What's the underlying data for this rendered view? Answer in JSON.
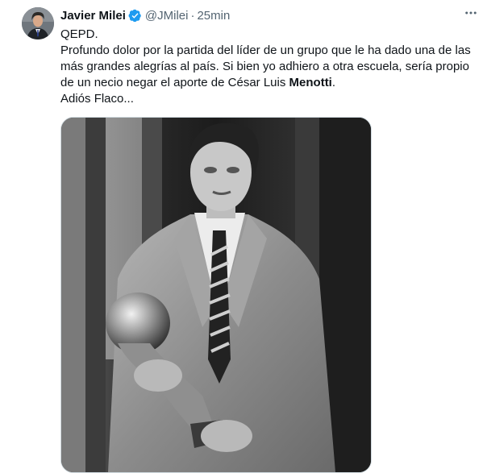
{
  "author": {
    "name": "Javier Milei",
    "handle": "@JMilei",
    "time": "25min",
    "verified": true,
    "verified_color": "#1d9bf0"
  },
  "tweet": {
    "line1": "QEPD.",
    "line2_part1": "Profundo dolor por la partida del líder de un grupo que le ha dado una de las más grandes alegrías al país. Si bien yo adhiero a otra escuela, sería propio de un necio negar el aporte de César Luis ",
    "line2_bold": "Menotti",
    "line2_end": ".",
    "line3": "Adiós Flaco..."
  },
  "icons": {
    "more": "more-horizontal-icon",
    "verified": "verified-badge-icon"
  }
}
